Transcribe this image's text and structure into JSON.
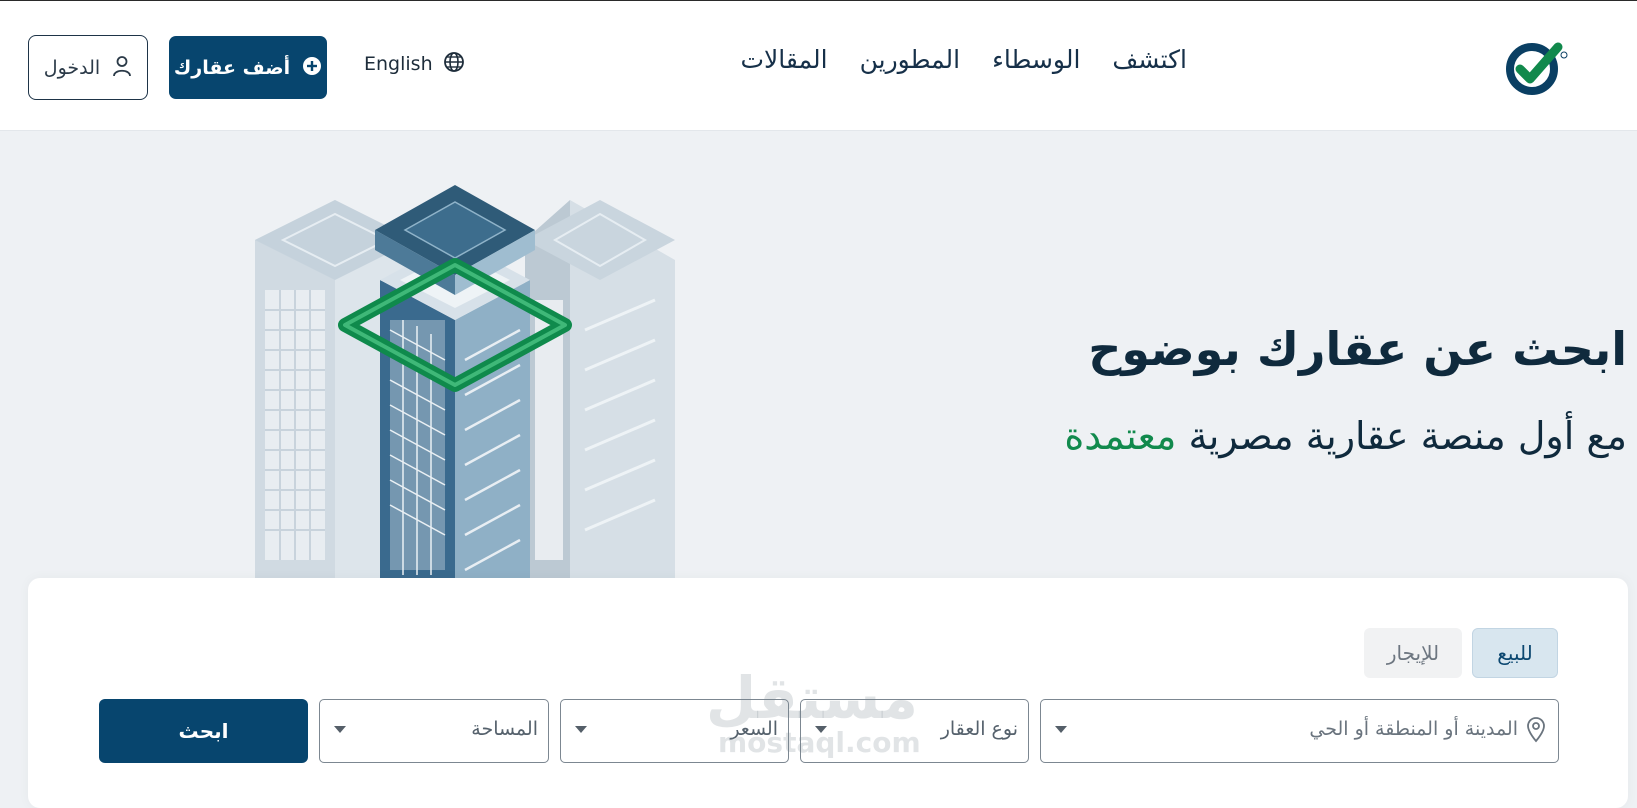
{
  "header": {
    "nav": [
      {
        "label": "اكتشف"
      },
      {
        "label": "الوسطاء"
      },
      {
        "label": "المطورين"
      },
      {
        "label": "المقالات"
      }
    ],
    "language_label": "English",
    "add_property_label": "أضف عقارك",
    "login_label": "الدخول"
  },
  "hero": {
    "title": "ابحث عن عقارك بوضوح",
    "subtitle_main": "مع أول منصة عقارية مصرية",
    "subtitle_accent": "معتمدة"
  },
  "search": {
    "tabs": [
      {
        "label": "للبيع",
        "active": true
      },
      {
        "label": "للإيجار",
        "active": false
      }
    ],
    "location_placeholder": "المدينة أو المنطقة أو الحي",
    "type_label": "نوع العقار",
    "price_label": "السعر",
    "area_label": "المساحة",
    "submit_label": "ابحث"
  },
  "watermark": {
    "ar": "مستقل",
    "en": "mostaql.com"
  },
  "colors": {
    "brand": "#07456e",
    "accent": "#118a4d",
    "text": "#0f2a3d",
    "background": "#eef1f4"
  },
  "icons": [
    "logo-check-icon",
    "globe-icon",
    "plus-circle-icon",
    "user-icon",
    "location-pin-icon",
    "caret-down-icon"
  ]
}
